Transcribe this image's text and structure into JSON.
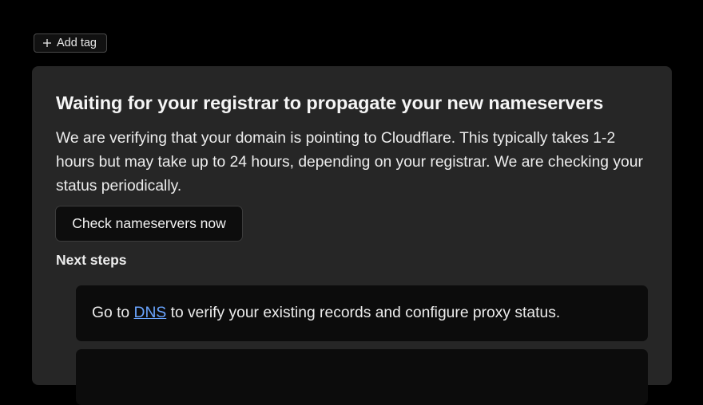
{
  "tags": {
    "add_tag_label": "Add tag"
  },
  "status_card": {
    "title": "Waiting for your registrar to propagate your new nameservers",
    "description": "We are verifying that your domain is pointing to Cloudflare. This typically takes 1-2 hours but may take up to 24 hours, depending on your registrar. We are checking your status periodically.",
    "check_button_label": "Check nameservers now",
    "next_steps_heading": "Next steps",
    "steps": [
      {
        "prefix": "Go to ",
        "link_label": "DNS",
        "suffix": " to verify your existing records and configure proxy status."
      }
    ]
  },
  "colors": {
    "page_background": "#000000",
    "card_background": "#262626",
    "step_background": "#0c0c0c",
    "link": "#6aa5ff"
  },
  "icons": [
    "plus-icon"
  ]
}
